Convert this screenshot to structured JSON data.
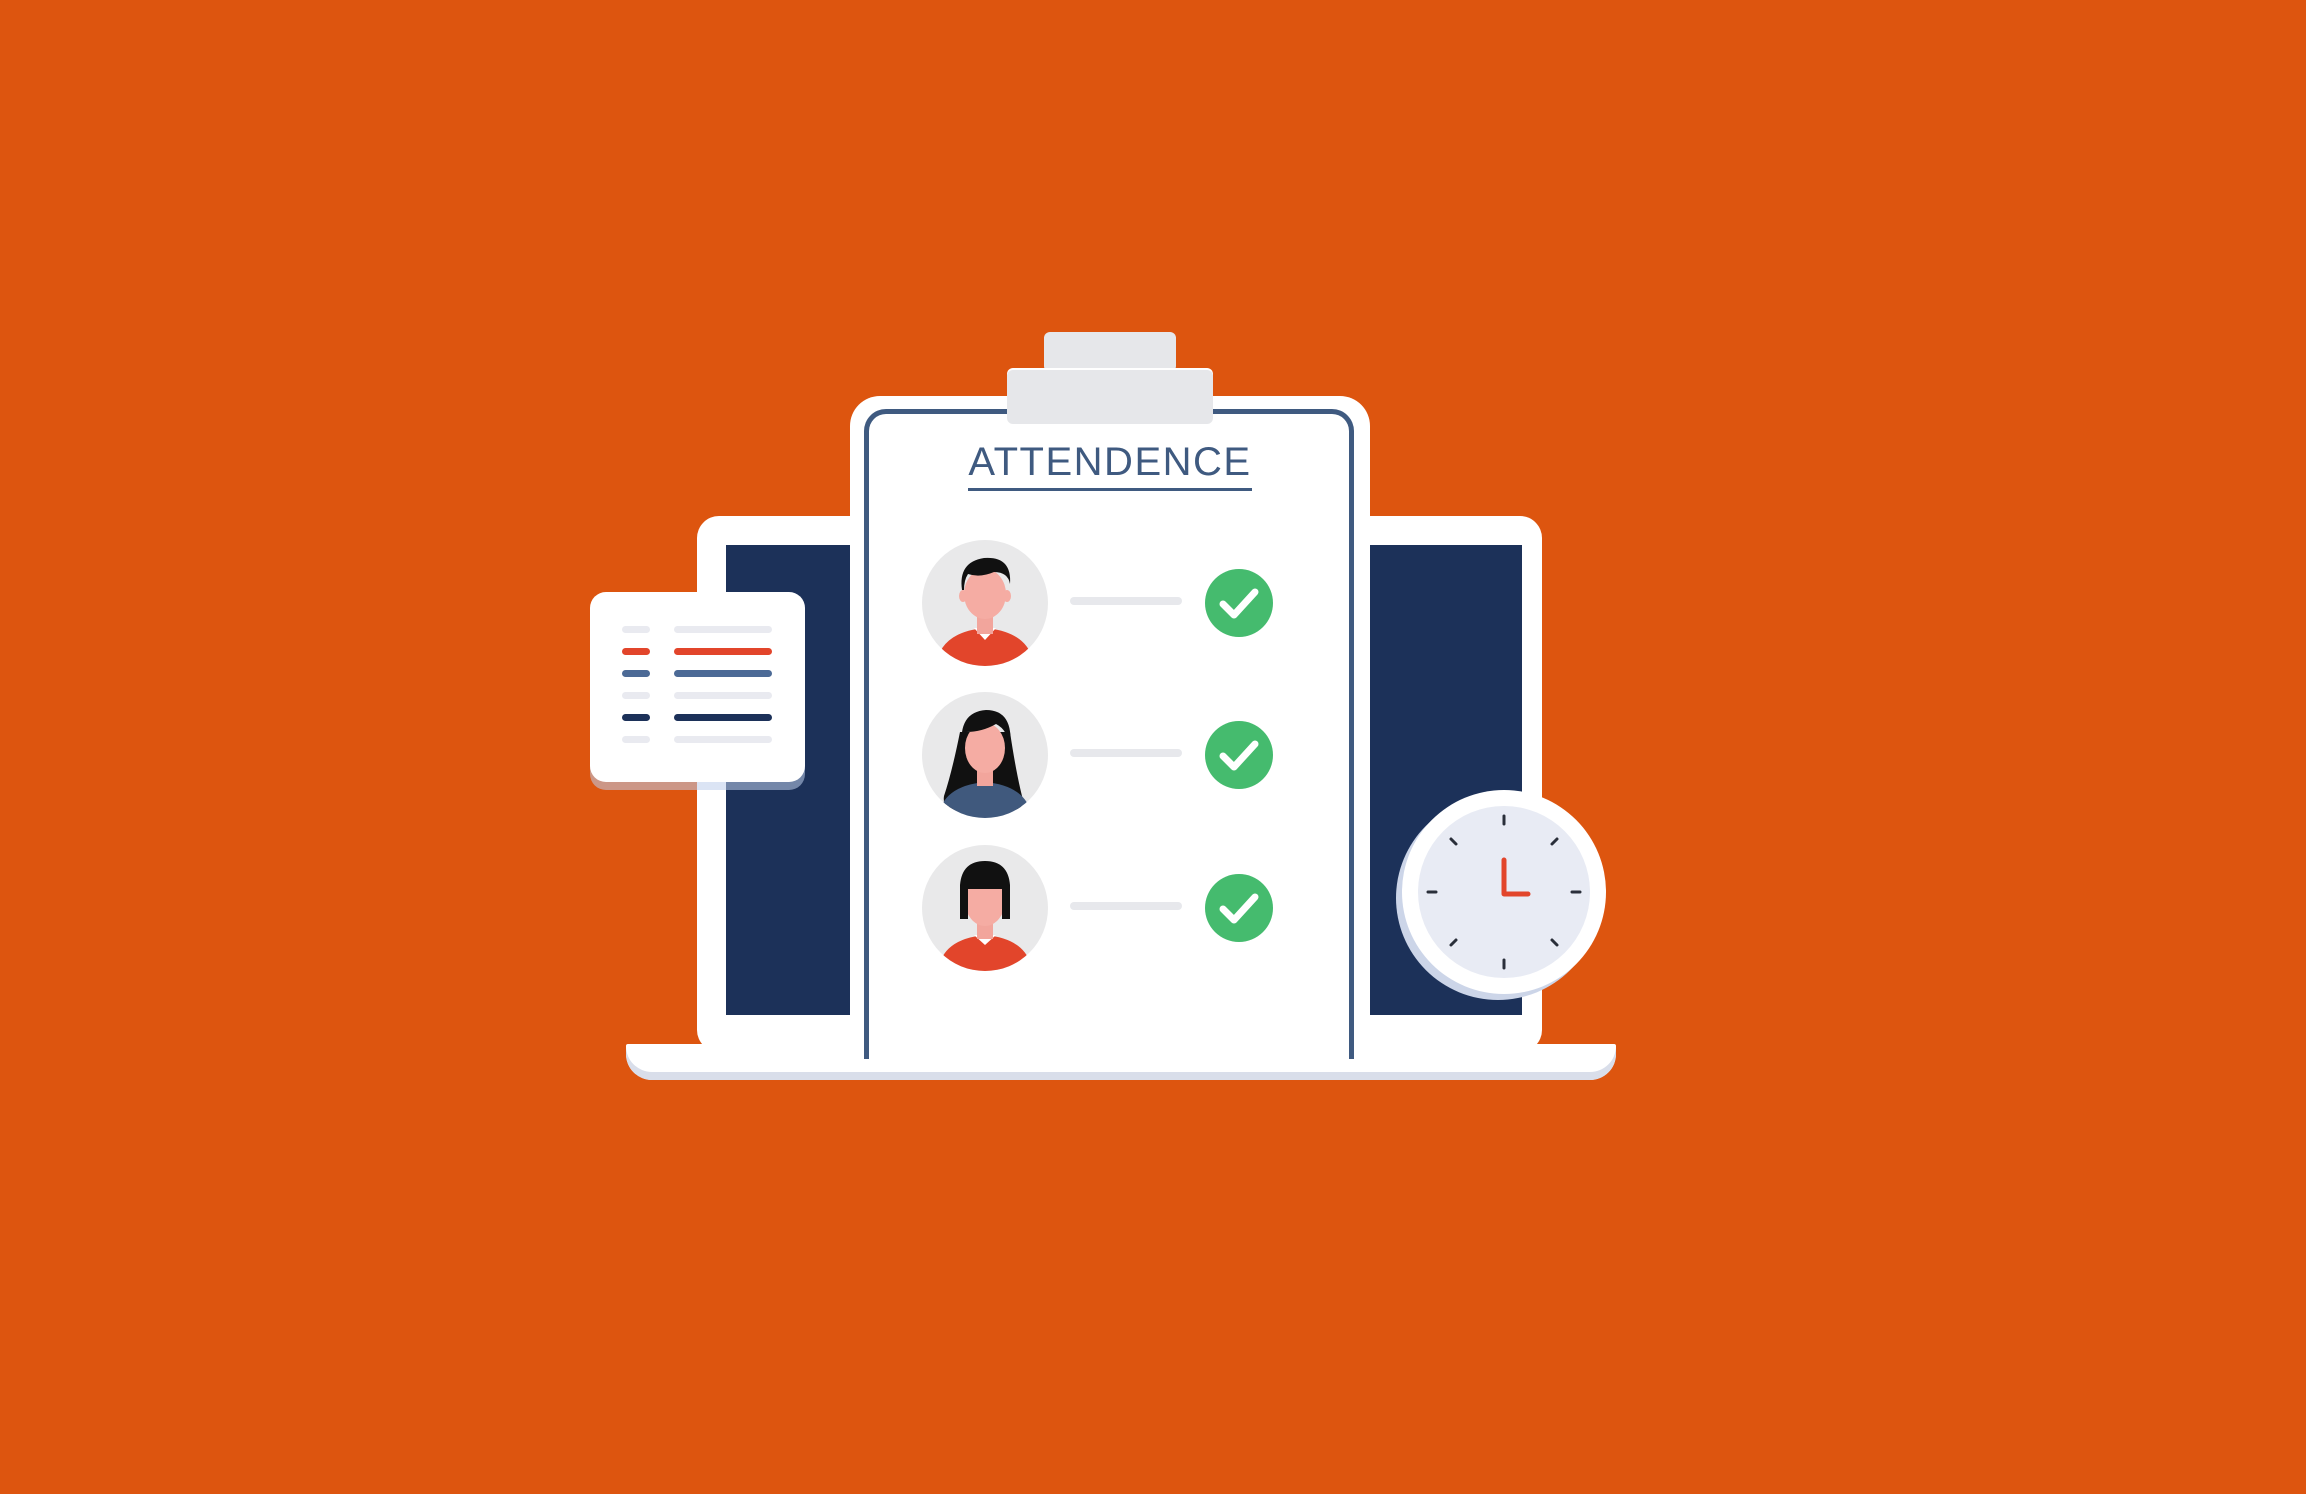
{
  "clipboard": {
    "title": "ATTENDENCE"
  },
  "attendees": [
    {
      "avatar": "man-avatar-icon",
      "status": "present",
      "status_icon": "check-circle-icon"
    },
    {
      "avatar": "woman-avatar-icon",
      "status": "present",
      "status_icon": "check-circle-icon"
    },
    {
      "avatar": "girl-avatar-icon",
      "status": "present",
      "status_icon": "check-circle-icon"
    }
  ],
  "icons": {
    "laptop": "laptop-icon",
    "clock": "clock-icon",
    "list_card": "list-card-icon"
  },
  "colors": {
    "background": "#DD550F",
    "navy": "#1C3159",
    "title_blue": "#3F5A80",
    "check_green": "#45BB6E",
    "accent_red": "#E2452B",
    "shirt_blue": "#40597D"
  }
}
